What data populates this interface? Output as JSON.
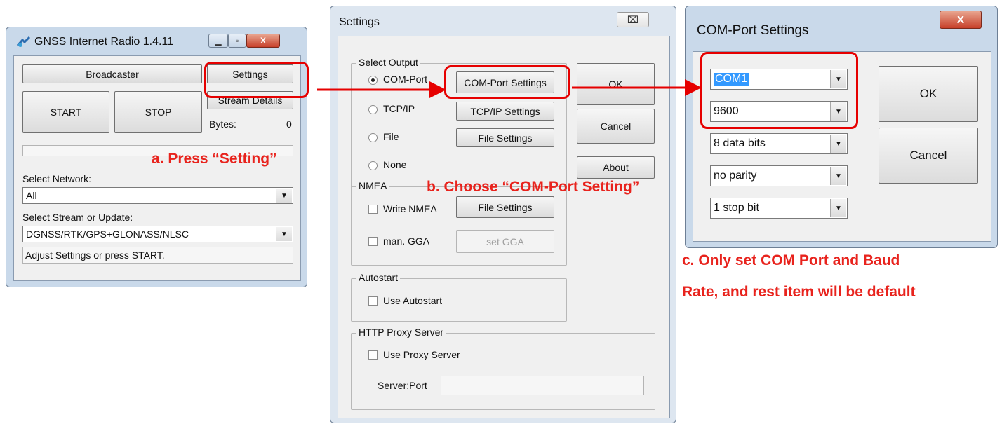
{
  "main_window": {
    "title": "GNSS Internet Radio 1.4.11",
    "broadcaster_label": "Broadcaster",
    "settings_label": "Settings",
    "start_label": "START",
    "stop_label": "STOP",
    "stream_details_label": "Stream Details",
    "bytes_label": "Bytes:",
    "bytes_value": "0",
    "select_network_label": "Select Network:",
    "network_value": "All",
    "select_stream_label": "Select Stream or Update:",
    "stream_value": "DGNSS/RTK/GPS+GLONASS/NLSC",
    "status_text": "Adjust Settings or press START."
  },
  "settings_dialog": {
    "title": "Settings",
    "select_output_label": "Select Output",
    "outputs": [
      "COM-Port",
      "TCP/IP",
      "File",
      "None"
    ],
    "selected_output": "COM-Port",
    "com_port_settings_label": "COM-Port Settings",
    "tcpip_settings_label": "TCP/IP Settings",
    "file_settings_label": "File Settings",
    "ok_label": "OK",
    "cancel_label": "Cancel",
    "about_label": "About",
    "nmea_label": "NMEA",
    "write_nmea_label": "Write NMEA",
    "nmea_file_settings_label": "File Settings",
    "man_gga_label": "man. GGA",
    "set_gga_label": "set GGA",
    "autostart_label": "Autostart",
    "use_autostart_label": "Use Autostart",
    "proxy_label": "HTTP Proxy Server",
    "use_proxy_label": "Use Proxy Server",
    "server_port_label": "Server:Port",
    "close_glyph": "⌧"
  },
  "com_dialog": {
    "title": "COM-Port Settings",
    "port_value": "COM1",
    "baud_value": "9600",
    "data_bits_value": "8 data bits",
    "parity_value": "no parity",
    "stop_bits_value": "1 stop bit",
    "ok_label": "OK",
    "cancel_label": "Cancel",
    "close_glyph": "X"
  },
  "annotations": {
    "step_a": "a. Press “Setting”",
    "step_b": "b. Choose “COM-Port Setting”",
    "step_c_line1": "c. Only set COM Port and Baud",
    "step_c_line2": "Rate, and rest item will be default"
  },
  "colors": {
    "highlight": "#e60000",
    "annotation": "#e8231d"
  }
}
